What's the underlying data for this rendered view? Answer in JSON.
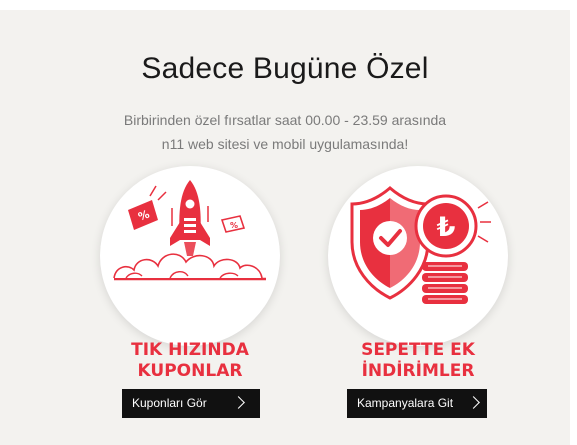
{
  "promo": {
    "title": "Sadece Bugüne Özel",
    "subtitle_line1": "Birbirinden özel fırsatlar saat 00.00 - 23.59 arasında",
    "subtitle_line2": "n11 web sitesi ve mobil uygulamasında!"
  },
  "cards": [
    {
      "icon": "rocket-coupon-icon",
      "title_line1": "TIK HIZINDA",
      "title_line2": "KUPONLAR",
      "button_label": "Kuponları Gör"
    },
    {
      "icon": "shield-lira-coins-icon",
      "title_line1": "SEPETTE EK",
      "title_line2": "İNDİRİMLER",
      "button_label": "Kampanyalara Git"
    }
  ],
  "colors": {
    "accent": "#e8303f",
    "panel_background": "#f3f2ef",
    "button_background": "#111111"
  }
}
